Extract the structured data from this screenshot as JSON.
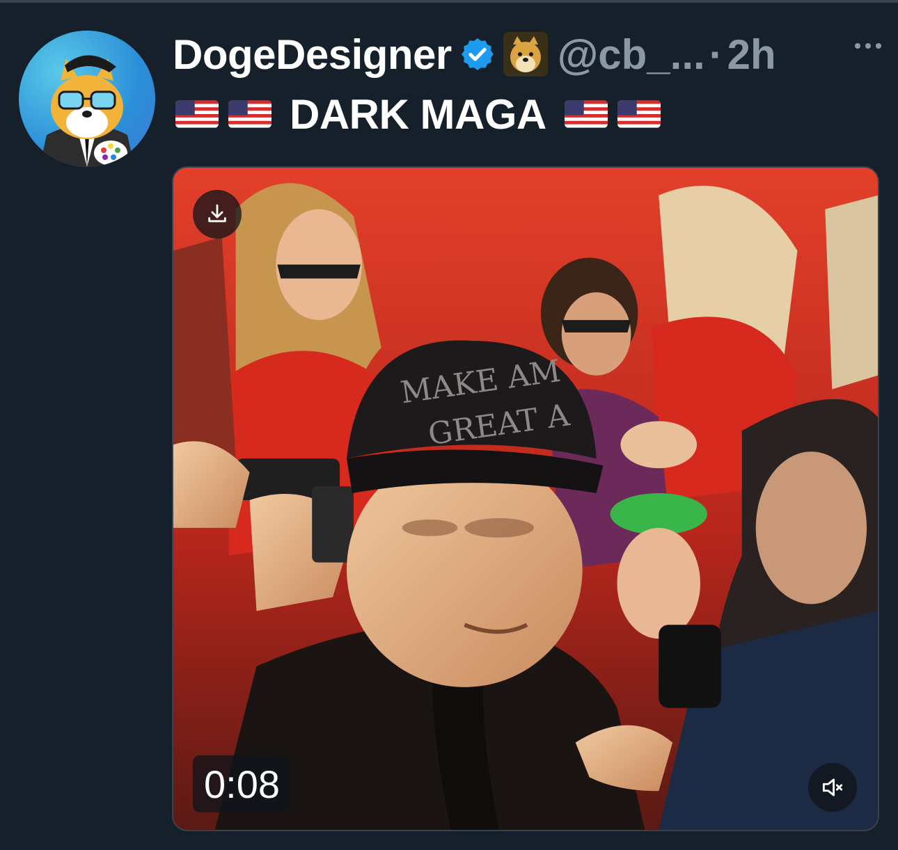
{
  "tweet": {
    "author_name": "DogeDesigner",
    "handle": "@cb_...",
    "separator": "·",
    "time": "2h",
    "text": "DARK MAGA",
    "flag_emoji": "🇺🇸"
  },
  "media": {
    "duration": "0:08",
    "cap_text_line1": "MAKE AM",
    "cap_text_line2": "GREAT A",
    "type": "video",
    "muted": true
  },
  "icons": {
    "verified": "verified-badge-icon",
    "affiliate": "doge-affiliate-icon",
    "more": "more-options-icon",
    "download": "download-icon",
    "mute": "speaker-muted-icon"
  },
  "colors": {
    "background": "#15202b",
    "muted_text": "#8b98a5",
    "verified": "#1d9bf0",
    "border": "#38444d"
  }
}
